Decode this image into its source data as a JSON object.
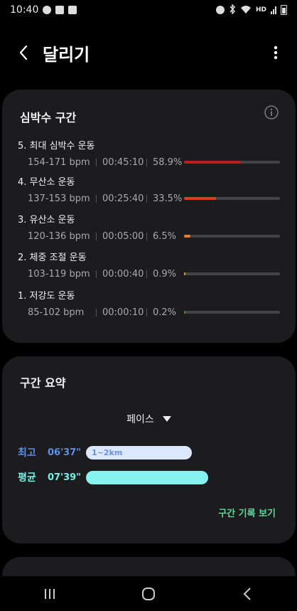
{
  "status": {
    "time": "10:40",
    "hd_label": "HD"
  },
  "header": {
    "title": "달리기"
  },
  "heart_rate": {
    "title": "심박수 구간",
    "zones": [
      {
        "name": "5. 최대 심박수 운동",
        "bpm": "154-171 bpm",
        "time": "00:45:10",
        "percent": "58.9%",
        "fraction": 0.589,
        "color": "#c21a1a"
      },
      {
        "name": "4. 무산소 운동",
        "bpm": "137-153 bpm",
        "time": "00:25:40",
        "percent": "33.5%",
        "fraction": 0.335,
        "color": "#e23c14"
      },
      {
        "name": "3. 유산소 운동",
        "bpm": "120-136 bpm",
        "time": "00:05:00",
        "percent": "6.5%",
        "fraction": 0.065,
        "color": "#ef7a22"
      },
      {
        "name": "2. 체중 조절 운동",
        "bpm": "103-119 bpm",
        "time": "00:00:40",
        "percent": "0.9%",
        "fraction": 0.009,
        "color": "#d9a82a"
      },
      {
        "name": "1. 저강도 운동",
        "bpm": "85-102 bpm",
        "time": "00:00:10",
        "percent": "0.2%",
        "fraction": 0.002,
        "color": "#4b8f3a"
      }
    ]
  },
  "summary": {
    "title": "구간 요약",
    "metric_selected": "페이스",
    "best": {
      "label": "최고",
      "value": "06'37\"",
      "segment": "1~2km",
      "color": "#5b8ff0",
      "bar_color": "#dce8ff",
      "segment_color": "#6d90d8"
    },
    "average": {
      "label": "평균",
      "value": "07'39\"",
      "color": "#6ff2e8",
      "bar_color": "#86f4ee"
    },
    "history_link": "구간 기록 보기"
  }
}
